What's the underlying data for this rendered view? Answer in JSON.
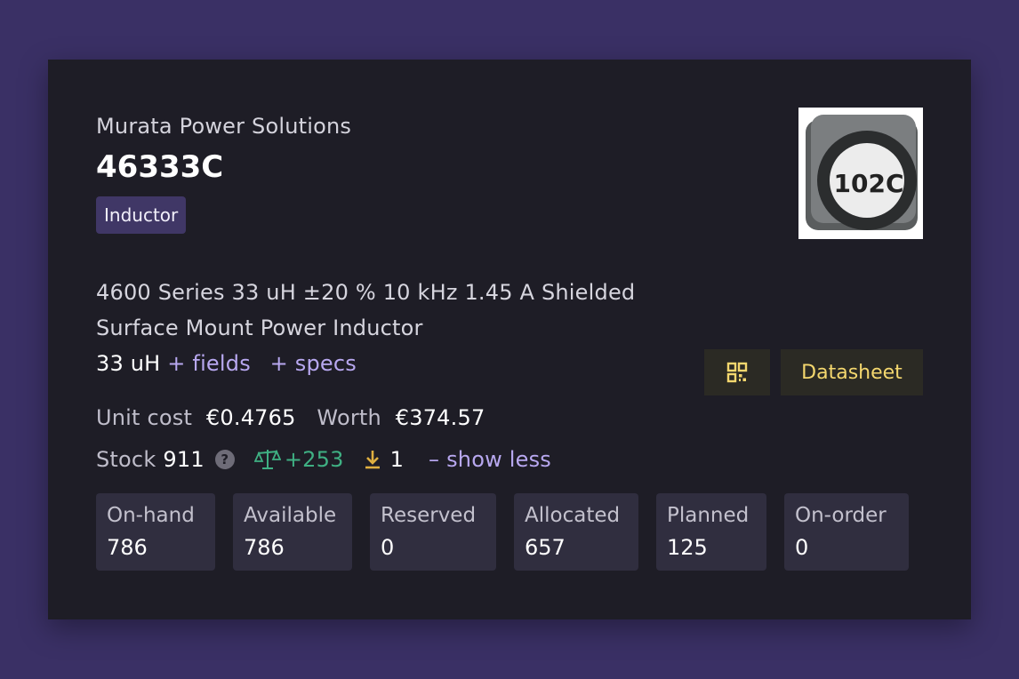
{
  "part": {
    "manufacturer": "Murata Power Solutions",
    "number": "46333C",
    "category": "Inductor",
    "image_marking": "102C",
    "description": "4600 Series 33 uH ±20 % 10 kHz 1.45 A Shielded Surface Mount Power Inductor",
    "value": "33 uH",
    "fields_link": "+ fields",
    "specs_link": "+ specs"
  },
  "actions": {
    "qr_icon": "qr-code-icon",
    "datasheet_label": "Datasheet"
  },
  "cost": {
    "unit_label": "Unit cost",
    "unit_value": "€0.4765",
    "worth_label": "Worth",
    "worth_value": "€374.57"
  },
  "stock": {
    "label": "Stock",
    "value": "911",
    "help_glyph": "?",
    "balance": "+253",
    "incoming": "1",
    "toggle_label": "– show less"
  },
  "tiles": [
    {
      "label": "On-hand",
      "value": "786"
    },
    {
      "label": "Available",
      "value": "786"
    },
    {
      "label": "Reserved",
      "value": "0"
    },
    {
      "label": "Allocated",
      "value": "657"
    },
    {
      "label": "Planned",
      "value": "125"
    },
    {
      "label": "On-order",
      "value": "0"
    }
  ],
  "colors": {
    "background": "#3a3065",
    "card": "#1e1d26",
    "badge": "#403766",
    "link": "#b8a8f0",
    "datasheet": "#f4d76e",
    "balance": "#3fb083",
    "incoming": "#e0b040"
  }
}
